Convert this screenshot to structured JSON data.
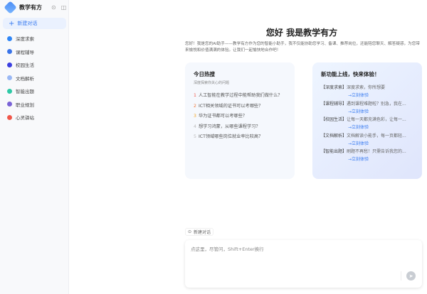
{
  "app": {
    "title": "教学有方",
    "new_chat": "新建对话"
  },
  "sidebar": {
    "items": [
      {
        "label": "深度求索",
        "color": "#2f86f6"
      },
      {
        "label": "课程辅导",
        "color": "#3a74e8"
      },
      {
        "label": "校园生活",
        "color": "#3b3fe0"
      },
      {
        "label": "文档解析",
        "color": "#9ab8f5"
      },
      {
        "label": "智能出题",
        "color": "#2ec9a6"
      },
      {
        "label": "职业规划",
        "color": "#7a63d6"
      },
      {
        "label": "心灵驿站",
        "color": "#f0574a"
      }
    ]
  },
  "main": {
    "title": "您好 我是教学有方",
    "intro": "您好！我是您的AI助手——教学有方作为您的智能小助手，我不仅能协助您学习、备课、推荐岗位，还能陪您聊天、解答疑惑，为您带来愉悦和价值满满的体验。让我们一起愉快地合作吧！",
    "hot": {
      "title": "今日热搜",
      "subtitle": "深度探索你关心的问题",
      "items": [
        {
          "rank": "1",
          "text": "人工智能在教学过程中能帮助我们做什么？",
          "color": "#f0574a"
        },
        {
          "rank": "2",
          "text": "ICT相关领域的证书可以考哪些？",
          "color": "#f07a3a"
        },
        {
          "rank": "3",
          "text": "华为证书都可以考哪些？",
          "color": "#f5a623"
        },
        {
          "rank": "4",
          "text": "想学习鸿蒙，从哪些课程学习？",
          "color": "#bbbbbb"
        },
        {
          "rank": "5",
          "text": "ICT领域哪些岗位就业率比较高？",
          "color": "#bbbbbb"
        }
      ]
    },
    "features": {
      "title": "新功能上线，快来体验！",
      "link": "→立刻体验",
      "items": [
        {
          "tag": "【深度求索】",
          "desc": "深度求索，你所想要"
        },
        {
          "tag": "【课程辅导】",
          "desc": "遇到课程难题啦？别急，我在..."
        },
        {
          "tag": "【校园生活】",
          "desc": "让每一天都充满色彩，让每一..."
        },
        {
          "tag": "【文档解析】",
          "desc": "文档解读小能手，每一页都轻..."
        },
        {
          "tag": "【智能出题】",
          "desc": "刷题不再愁！只需告诉我您的..."
        }
      ]
    },
    "new_chat": "新建对话",
    "input_placeholder": "点这里，尽管问，Shift+Enter换行"
  }
}
